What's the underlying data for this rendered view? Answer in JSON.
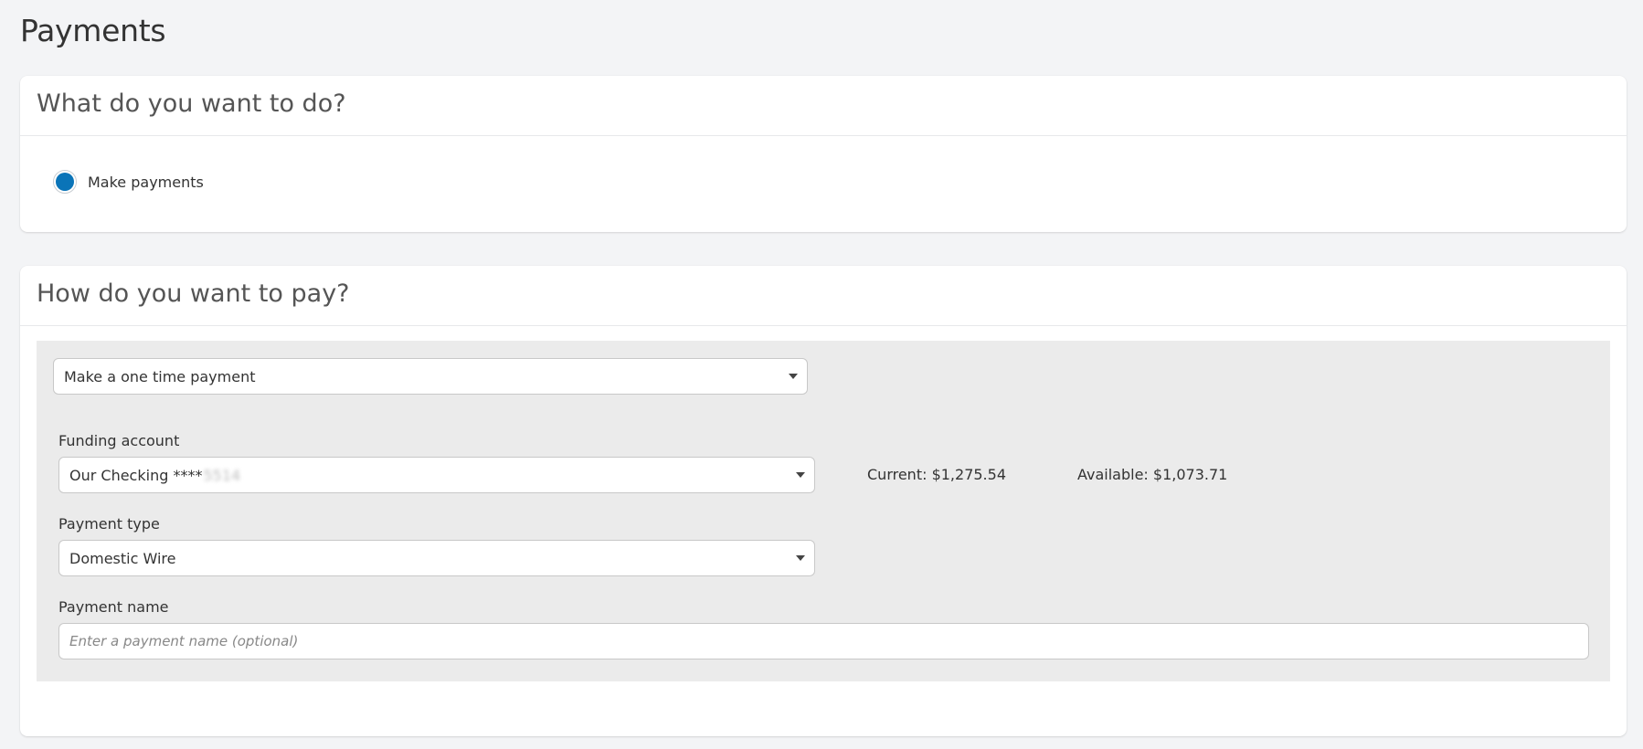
{
  "page": {
    "title": "Payments"
  },
  "action_section": {
    "title": "What do you want to do?",
    "option_label": "Make payments",
    "option_selected": true
  },
  "payment_section": {
    "title": "How do you want to pay?",
    "payment_mode": {
      "value": "Make a one time payment"
    },
    "funding_account": {
      "label": "Funding account",
      "value": "Our Checking ****",
      "masked_suffix": "5514",
      "current_balance": "Current: $1,275.54",
      "available_balance": "Available: $1,073.71"
    },
    "payment_type": {
      "label": "Payment type",
      "value": "Domestic Wire"
    },
    "payment_name": {
      "label": "Payment name",
      "placeholder": "Enter a payment name (optional)",
      "value": ""
    }
  },
  "colors": {
    "background": "#f3f4f6",
    "card": "#ffffff",
    "form_area": "#ebebeb",
    "accent": "#0a74b8"
  },
  "icons": {
    "dropdown": "chevron-down-icon",
    "radio": "radio-selected-icon"
  }
}
